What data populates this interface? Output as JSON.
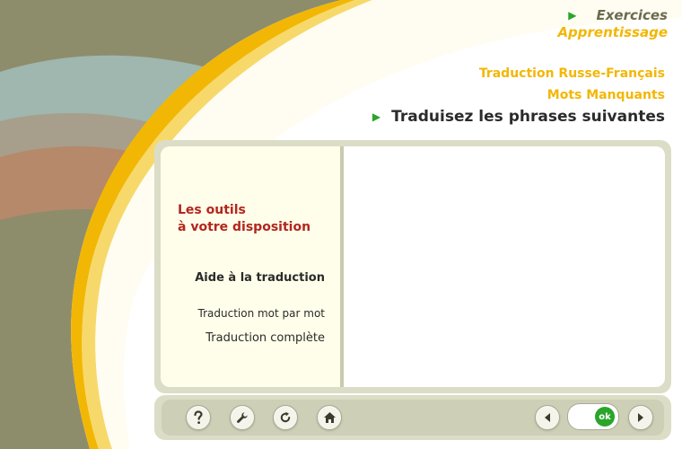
{
  "nav": {
    "exercises_label": "Exercices",
    "learning_label": "Apprentissage"
  },
  "breadcrumb": {
    "level1": "Traduction Russe-Français",
    "level2": "Mots Manquants",
    "current": "Traduisez les phrases suivantes"
  },
  "tools": {
    "heading_line1": "Les outils",
    "heading_line2": "à votre disposition",
    "translation_help": "Aide à la traduction",
    "word_by_word": "Traduction mot par mot",
    "full_translation": "Traduction complète"
  },
  "toolbar": {
    "ok_label": "ok",
    "icons": [
      "help-icon",
      "wrench-icon",
      "reload-icon",
      "home-icon",
      "prev-arrow-icon",
      "next-arrow-icon"
    ]
  },
  "colors": {
    "accent_yellow": "#f2b705",
    "accent_green": "#2aa52a",
    "heading_red": "#b3261e",
    "panel_olive": "#dcddc6"
  }
}
